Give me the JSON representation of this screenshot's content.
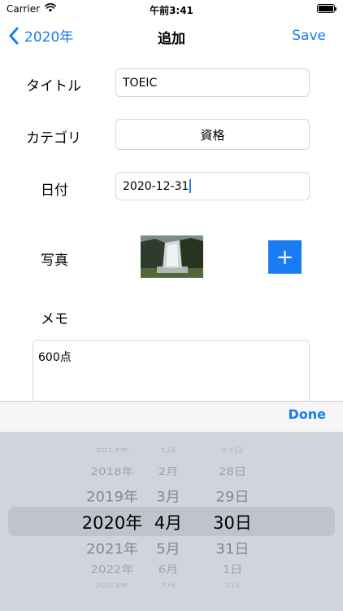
{
  "status_bar": {
    "carrier": "Carrier",
    "time": "午前3:41"
  },
  "nav": {
    "back_label": "2020年",
    "title": "追加",
    "save_label": "Save"
  },
  "form": {
    "title_label": "タイトル",
    "title_value": "TOEIC",
    "category_label": "カテゴリ",
    "category_value": "資格",
    "date_label": "日付",
    "date_value": "2020-12-31",
    "photo_label": "写真",
    "add_photo_symbol": "+",
    "memo_label": "メモ",
    "memo_value": "600点"
  },
  "picker": {
    "done_label": "Done",
    "years": [
      "2017年",
      "2018年",
      "2019年",
      "2020年",
      "2021年",
      "2022年",
      "2023年"
    ],
    "months": [
      "1月",
      "2月",
      "3月",
      "4月",
      "5月",
      "6月",
      "7月"
    ],
    "days": [
      "27日",
      "28日",
      "29日",
      "30日",
      "31日",
      "1日",
      "2日"
    ],
    "selected_index": 3
  }
}
